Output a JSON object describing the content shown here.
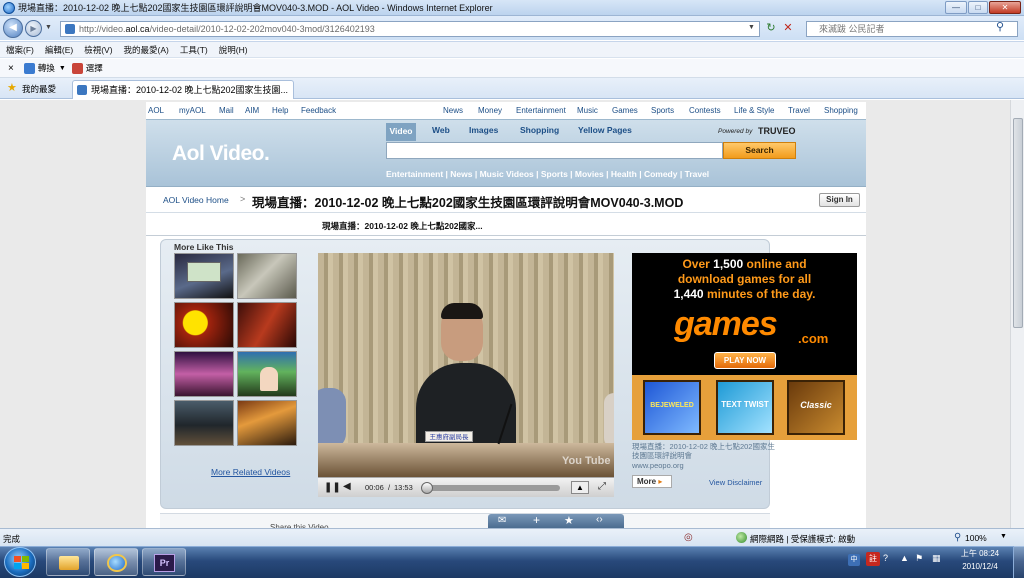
{
  "window": {
    "title": "現場直播：2010-12-02 晚上七點202國家生技園區環評說明會MOV040-3.MOD - AOL Video - Windows Internet Explorer",
    "min_glyph": "—",
    "max_glyph": "□",
    "close_glyph": "✕"
  },
  "address_bar": {
    "prefix": "http://video.",
    "domain": "aol.ca",
    "path": "/video-detail/2010-12-02-202mov040-3mod/3126402193"
  },
  "search_bar": {
    "placeholder": "來滅跋 公民記者"
  },
  "menu": [
    "檔案(F)",
    "編輯(E)",
    "檢視(V)",
    "我的最愛(A)",
    "工具(T)",
    "說明(H)"
  ],
  "links_bar": {
    "close": "×",
    "translate": "轉換",
    "select": "選擇"
  },
  "favorites": {
    "label": "我的最愛",
    "tab_title": "現場直播：2010-12-02 晚上七點202國家生技園..."
  },
  "aol": {
    "top_links_left": [
      "AOL",
      "myAOL",
      "Mail",
      "AIM",
      "Help",
      "Feedback"
    ],
    "top_links_right": [
      "News",
      "Money",
      "Entertainment",
      "Music",
      "Games",
      "Sports",
      "Contests",
      "Life & Style",
      "Travel",
      "Shopping"
    ],
    "logo": "Aol Video.",
    "search_tabs": [
      "Video",
      "Web",
      "Images",
      "Shopping",
      "Yellow Pages"
    ],
    "powered_by": "Powered by",
    "powered_brand": "TRUVEO",
    "search_button": "Search",
    "categories": [
      "Entertainment",
      "News",
      "Music Videos",
      "Sports",
      "Movies",
      "Health",
      "Comedy",
      "Travel"
    ],
    "breadcrumb_home": "AOL Video Home",
    "breadcrumb_sep": ">",
    "video_title": "現場直播：2010-12-02 晚上七點202國家生技園區環評說明會MOV040-3.MOD",
    "sign_in": "Sign In",
    "subtitle": "現場直播：2010-12-02 晚上七點202國家...",
    "more_like_this": "More Like This",
    "more_related": "More Related Videos",
    "time_current": "00:06",
    "time_total": "13:53",
    "progress_fraction": 0.0072,
    "youtube_mark": "You Tube",
    "name_plate": "王惠府副局長",
    "video_caption": "現場直播：2010-12-02 晚上七點202國家生技園區環評說明會",
    "video_source": "www.peopo.org",
    "more_button": "More",
    "view_disclaimer": "View Disclaimer",
    "share_label": "Share this Video",
    "ad": {
      "headline_1": "Over",
      "num_1": "1,500",
      "headline_1b": "online and",
      "headline_2": "download games for all",
      "num_2": "1,440",
      "headline_3": "minutes of the day.",
      "brand": "games",
      "brand_suffix": ".com",
      "play_now": "PLAY NOW",
      "game_1": "BEJEWELED",
      "game_2": "TEXT TWIST",
      "game_3": "Classic"
    }
  },
  "status_bar": {
    "left": "完成",
    "zone": "網際網路 | 受保護模式: 啟動",
    "zoom": "100%"
  },
  "taskbar": {
    "time": "上午 08:24",
    "date": "2010/12/4",
    "ime": "註"
  }
}
